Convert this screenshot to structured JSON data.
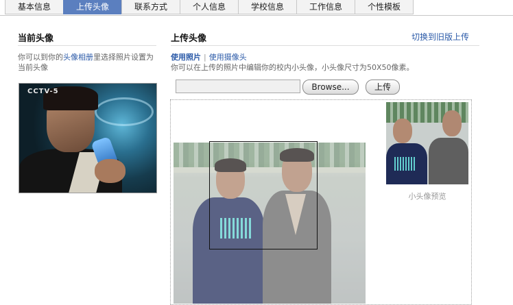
{
  "tabs": [
    {
      "label": "基本信息",
      "active": false
    },
    {
      "label": "上传头像",
      "active": true
    },
    {
      "label": "联系方式",
      "active": false
    },
    {
      "label": "个人信息",
      "active": false
    },
    {
      "label": "学校信息",
      "active": false
    },
    {
      "label": "工作信息",
      "active": false
    },
    {
      "label": "个性模板",
      "active": false
    }
  ],
  "left": {
    "title": "当前头像",
    "desc_before": "你可以到你的",
    "desc_link": "头像相册",
    "desc_after": "里选择照片设置为当前头像",
    "avatar_logo": "CCTV-5"
  },
  "right": {
    "title": "上传头像",
    "switch_link": "切换到旧版上传",
    "method_active": "使用照片",
    "method_separator": "|",
    "method_other": "使用摄像头",
    "hint": "你可以在上传的照片中编辑你的校内小头像，小头像尺寸为50X50像素。",
    "file_value": "",
    "browse_label": "Browse...",
    "upload_label": "上传",
    "preview_label": "小头像预览"
  },
  "colors": {
    "active_tab": "#5b7fbf",
    "link": "#2b5aa8"
  }
}
